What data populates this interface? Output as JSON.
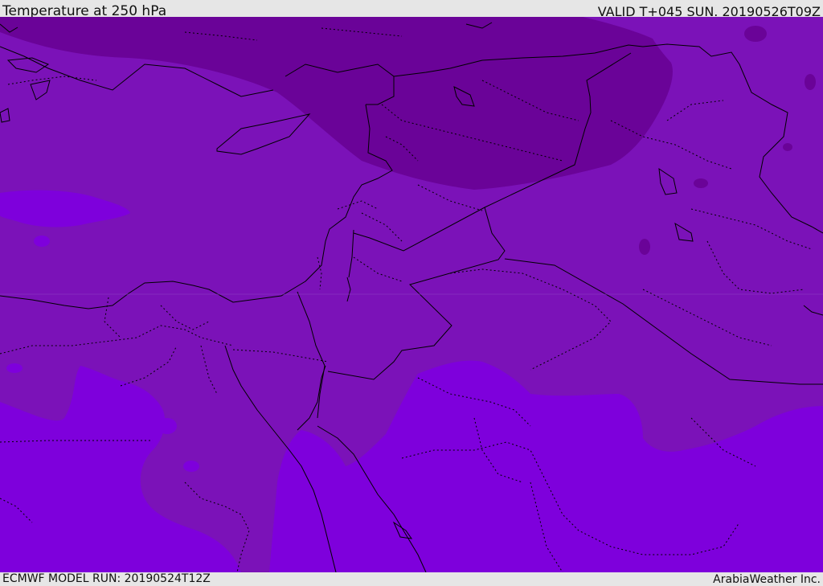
{
  "header": {
    "title": "Temperature at 250 hPa",
    "valid": "VALID T+045 SUN. 20190526T09Z"
  },
  "footer": {
    "model_run": "ECMWF MODEL RUN: 20190524T12Z",
    "credit": "ArabiaWeather Inc."
  },
  "colors": {
    "background_band": "#7b12b8",
    "cold_band": "#6a0398",
    "warm_band": "#7e00dc",
    "borders": "#000000"
  }
}
